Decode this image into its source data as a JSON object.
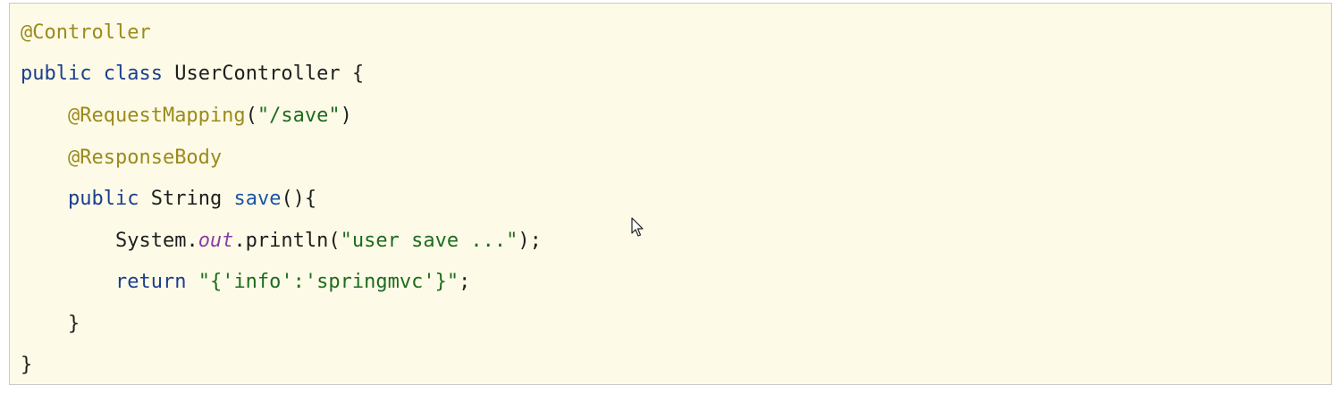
{
  "colors": {
    "background": "#fdfbe7",
    "border": "#c9c9c9",
    "annotation": "#9b8a1d",
    "keyword": "#1a3e8f",
    "string": "#1e6b1e",
    "method": "#1a55a8",
    "field": "#8a3ea6",
    "text": "#1e1e1e"
  },
  "icons": {
    "pointer": "mouse-pointer-icon"
  },
  "code": {
    "line1": {
      "ann": "@Controller"
    },
    "line2": {
      "kw1": "public",
      "kw2": "class",
      "name": "UserController",
      "brace": "{"
    },
    "line3": {
      "ann": "@RequestMapping",
      "open": "(",
      "str": "\"/save\"",
      "close": ")"
    },
    "line4": {
      "ann": "@ResponseBody"
    },
    "line5": {
      "kw": "public",
      "type": "String",
      "method": "save",
      "rest": "(){"
    },
    "line6": {
      "obj": "System.",
      "field": "out",
      "call": ".println(",
      "str": "\"user save ...\"",
      "end": ");"
    },
    "line7": {
      "kw": "return",
      "str": "\"{'info':'springmvc'}\"",
      "end": ";"
    },
    "line8": {
      "brace": "}"
    },
    "line9": {
      "brace": "}"
    }
  }
}
